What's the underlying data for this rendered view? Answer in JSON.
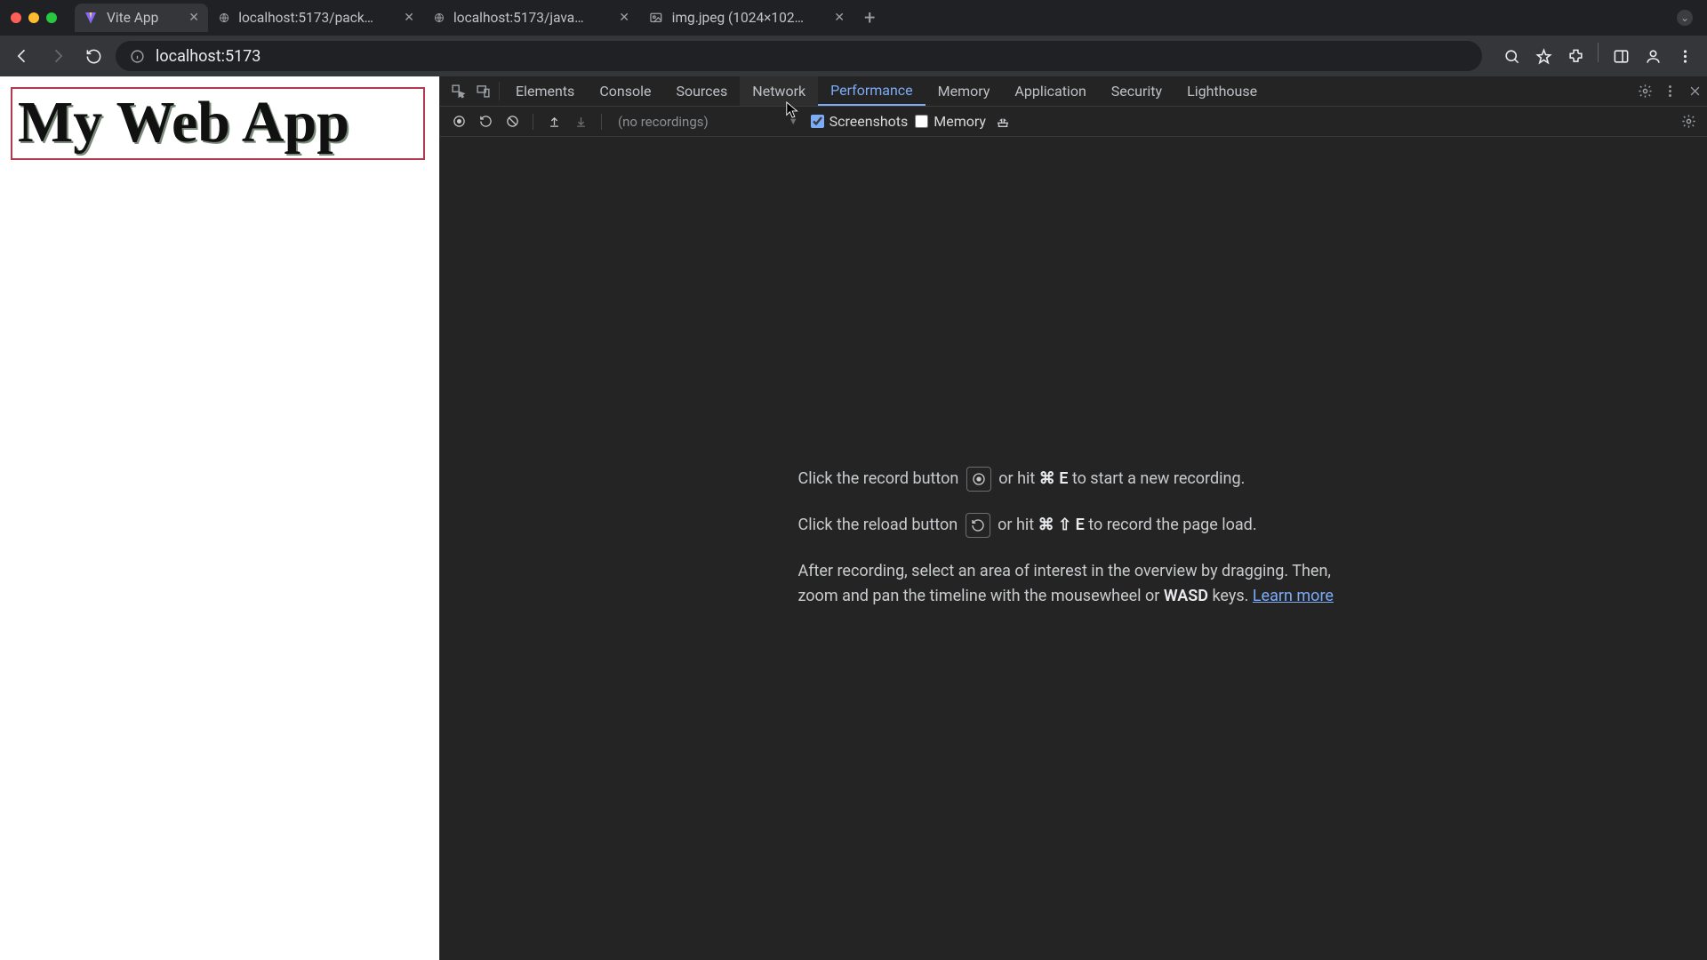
{
  "browser": {
    "tabs": [
      {
        "title": "Vite App",
        "active": true
      },
      {
        "title": "localhost:5173/package.json",
        "active": false
      },
      {
        "title": "localhost:5173/javascript.svg",
        "active": false
      },
      {
        "title": "img.jpeg (1024×1024)",
        "active": false
      }
    ],
    "url": "localhost:5173"
  },
  "page": {
    "heading": "My Web App"
  },
  "devtools": {
    "tabs": [
      "Elements",
      "Console",
      "Sources",
      "Network",
      "Performance",
      "Memory",
      "Application",
      "Security",
      "Lighthouse"
    ],
    "hover_tab_index": 3,
    "active_tab_index": 4,
    "recordings_placeholder": "(no recordings)",
    "screenshots_checked": true,
    "memory_checked": false,
    "screenshots_label": "Screenshots",
    "memory_label": "Memory",
    "msg": {
      "line1_a": "Click the record button",
      "line1_b": "or hit ",
      "line1_key": "⌘ E",
      "line1_c": " to start a new recording.",
      "line2_a": "Click the reload button",
      "line2_b": "or hit ",
      "line2_key": "⌘ ⇧ E",
      "line2_c": " to record the page load.",
      "line3_a": "After recording, select an area of interest in the overview by dragging. Then, zoom and pan the timeline with the mousewheel or ",
      "line3_bold": "WASD",
      "line3_b": " keys. ",
      "learn_more": "Learn more"
    }
  }
}
